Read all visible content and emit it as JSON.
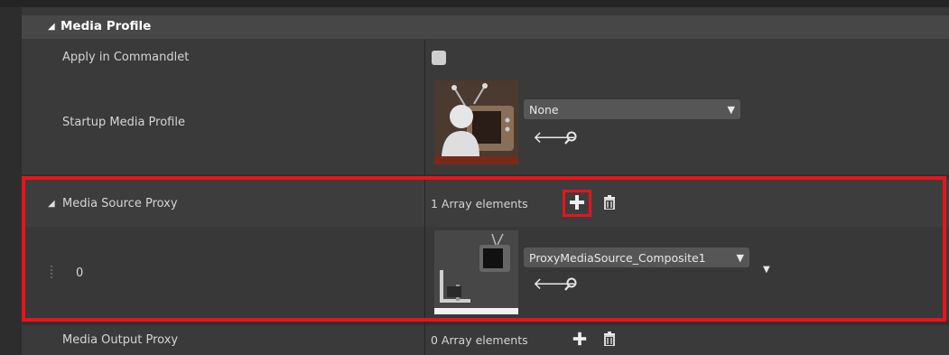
{
  "section": {
    "title": "Media Profile"
  },
  "rows": {
    "apply_in_commandlet": {
      "label": "Apply in Commandlet",
      "checked": false
    },
    "startup_media_profile": {
      "label": "Startup Media Profile",
      "value": "None",
      "thumbnail_icon": "media-profile-tv-person-icon"
    },
    "media_source_proxy": {
      "label": "Media Source Proxy",
      "array_count": "1 Array elements",
      "element_index": "0",
      "element_value": "ProxyMediaSource_Composite1",
      "thumbnail_icon": "proxy-media-source-icon"
    },
    "media_output_proxy": {
      "label": "Media Output Proxy",
      "array_count": "0 Array elements"
    }
  },
  "icons": {
    "collapse": "triangle-down-icon",
    "use_selected": "arrow-left-icon",
    "browse": "search-icon",
    "add": "plus-icon",
    "delete": "trash-icon",
    "dropdown": "chevron-down-icon"
  },
  "colors": {
    "panel_bg": "#383838",
    "header_bg": "#474747",
    "highlight": "#e8141b"
  }
}
